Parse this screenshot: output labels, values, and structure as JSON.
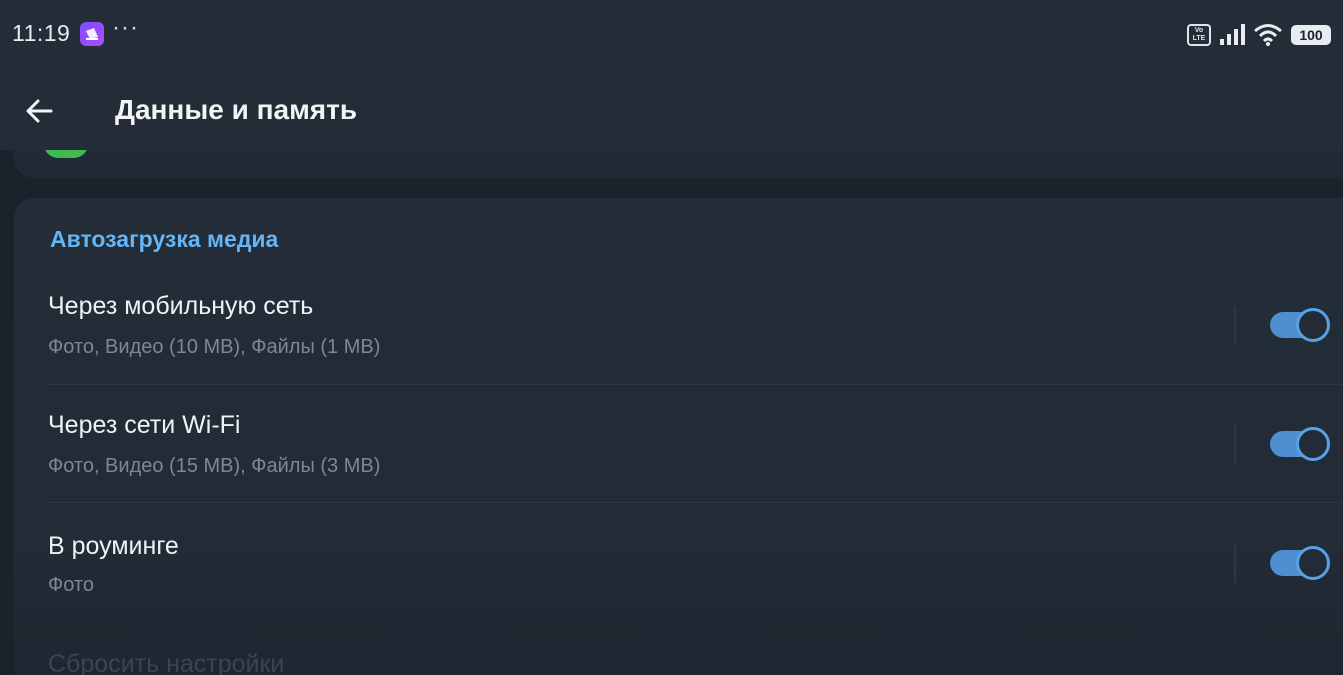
{
  "status_bar": {
    "time": "11:19",
    "dots": "···",
    "volte": "Vo\nLTE",
    "battery": "100"
  },
  "app_bar": {
    "title": "Данные и память"
  },
  "auto_download": {
    "header": "Автозагрузка медиа",
    "rows": [
      {
        "title": "Через мобильную сеть",
        "subtitle": "Фото, Видео (10 MB), Файлы (1 MB)",
        "enabled": true
      },
      {
        "title": "Через сети Wi-Fi",
        "subtitle": "Фото, Видео (15 MB), Файлы (3 MB)",
        "enabled": true
      },
      {
        "title": "В роуминге",
        "subtitle": "Фото",
        "enabled": true
      }
    ],
    "reset_label": "Сбросить настройки"
  },
  "colors": {
    "accent": "#64b5f6",
    "toggle_on": "#4f8fd0",
    "background": "#1a222c",
    "card": "#232c37"
  },
  "icons": {
    "back": "arrow-left-icon",
    "app": "app-notification-icon",
    "signal": "cellular-signal-icon",
    "wifi": "wifi-icon",
    "battery": "battery-icon"
  }
}
